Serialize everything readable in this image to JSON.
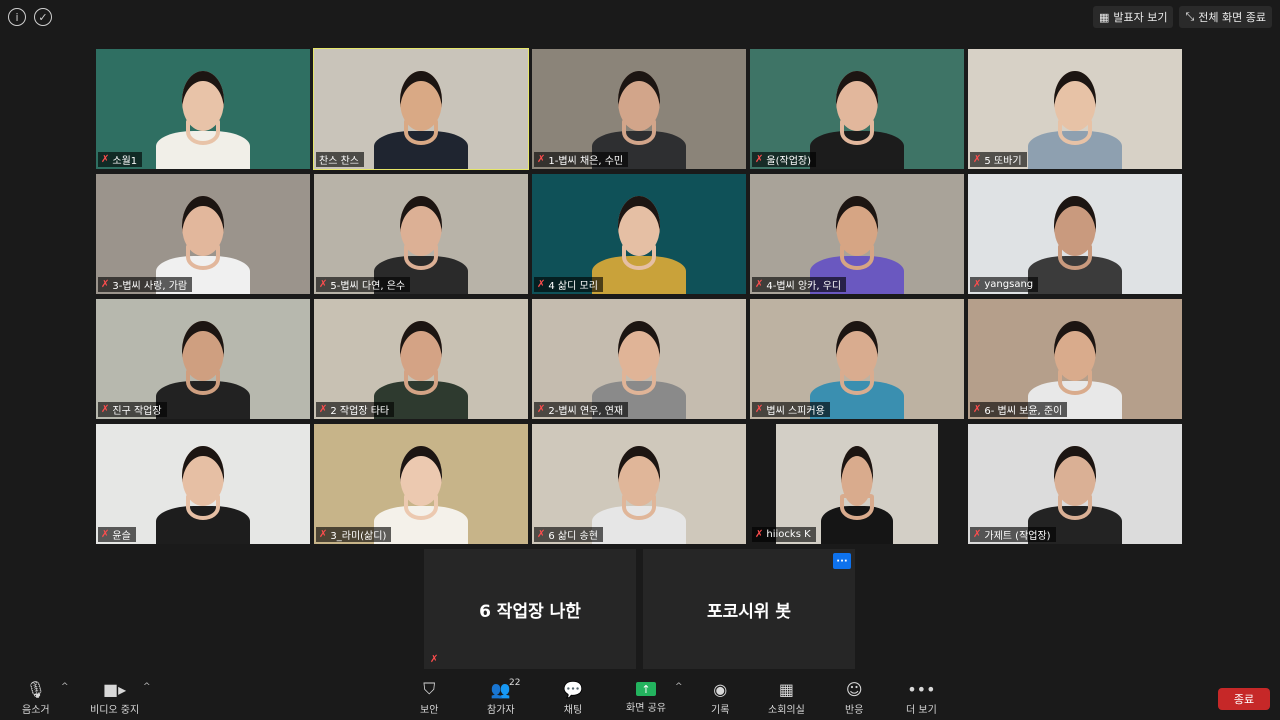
{
  "top_left_icons": [
    "info-icon",
    "shield-check-icon"
  ],
  "top_right": {
    "speaker_view_label": "발표자 보기",
    "exit_fullscreen_label": "전체 화면 종료"
  },
  "participants": [
    {
      "name": "소월1",
      "muted": true,
      "bg": "#2f6f62",
      "skin": "#e8c3a8",
      "shirt": "#f1efe8"
    },
    {
      "name": "찬스 찬스",
      "muted": false,
      "active": true,
      "bg": "#c9c4ba",
      "skin": "#d9a985",
      "shirt": "#1f2530"
    },
    {
      "name": "1-볍씨 채은, 수민",
      "muted": true,
      "bg": "#8b8479",
      "skin": "#d2a58a",
      "shirt": "#2e2f31"
    },
    {
      "name": "울(작업장)",
      "muted": true,
      "bg": "#3e7466",
      "skin": "#e2b79c",
      "shirt": "#1c1c1c"
    },
    {
      "name": "5 또바기",
      "muted": true,
      "bg": "#d7d1c6",
      "skin": "#e7c2a6",
      "shirt": "#8ea0b0"
    },
    {
      "name": "3-볍씨 사랑, 가람",
      "muted": true,
      "bg": "#9b948c",
      "skin": "#e2b79c",
      "shirt": "#f0f0f0"
    },
    {
      "name": "5-볍씨 다연, 은수",
      "muted": true,
      "bg": "#b8b3a8",
      "skin": "#dcb095",
      "shirt": "#2a2a2a"
    },
    {
      "name": "4 삶디 모리",
      "muted": true,
      "bg": "#0f5158",
      "skin": "#e5bfa4",
      "shirt": "#c9a23a"
    },
    {
      "name": "4-볍씨 앙카, 우디",
      "muted": true,
      "bg": "#a9a399",
      "skin": "#d6a584",
      "shirt": "#6a58c0"
    },
    {
      "name": "yangsang",
      "muted": true,
      "bg": "#dfe2e4",
      "skin": "#c99a7e",
      "shirt": "#3b3b3b"
    },
    {
      "name": "진구 작업장",
      "muted": true,
      "bg": "#b7b8ae",
      "skin": "#cf9f80",
      "shirt": "#222"
    },
    {
      "name": "2 작업장 타타",
      "muted": true,
      "bg": "#c8c1b3",
      "skin": "#d4a385",
      "shirt": "#2e3a2f"
    },
    {
      "name": "2-볍씨 연우, 연재",
      "muted": true,
      "bg": "#c5bcaf",
      "skin": "#e0b497",
      "shirt": "#8a8a8a"
    },
    {
      "name": "볍씨 스피커용",
      "muted": true,
      "bg": "#bdb2a2",
      "skin": "#d9ac8f",
      "shirt": "#3a8fb0"
    },
    {
      "name": "6- 볍씨 보윤, 준이",
      "muted": true,
      "bg": "#b59f8b",
      "skin": "#d9ab8c",
      "shirt": "#e8e8e8"
    },
    {
      "name": "윤슬",
      "muted": true,
      "bg": "#e6e7e5",
      "skin": "#e6bfa4",
      "shirt": "#1d1d1d"
    },
    {
      "name": "3_라미(삶디)",
      "muted": true,
      "bg": "#c7b489",
      "skin": "#ecc9b0",
      "shirt": "#f4f1ea"
    },
    {
      "name": "6 삶디 송현",
      "muted": true,
      "bg": "#cfc8bb",
      "skin": "#e0b699",
      "shirt": "#e6e6e6"
    },
    {
      "name": "hiiocks K",
      "muted": true,
      "narrow": true,
      "bg": "#d3cfc6",
      "skin": "#d9ab8d",
      "shirt": "#151515"
    },
    {
      "name": "가제트 (작업장)",
      "muted": true,
      "bg": "#dcdcdc",
      "skin": "#dab095",
      "shirt": "#232323"
    }
  ],
  "audio_only": [
    {
      "name": "6 작업장 나한",
      "muted": true
    },
    {
      "name": "포코시위 봇",
      "muted": false,
      "has_menu": true
    }
  ],
  "toolbar": {
    "mute_label": "음소거",
    "video_label": "비디오 중지",
    "security_label": "보안",
    "participants_label": "참가자",
    "participants_count": "22",
    "chat_label": "채팅",
    "share_label": "화면 공유",
    "record_label": "기록",
    "breakout_label": "소회의실",
    "reactions_label": "반응",
    "more_label": "더 보기",
    "end_label": "종료"
  },
  "colors": {
    "accent_share": "#23b35e",
    "end_button": "#c62828",
    "active_speaker_border": "#e6e66a",
    "muted_icon": "#ff4d4d"
  }
}
